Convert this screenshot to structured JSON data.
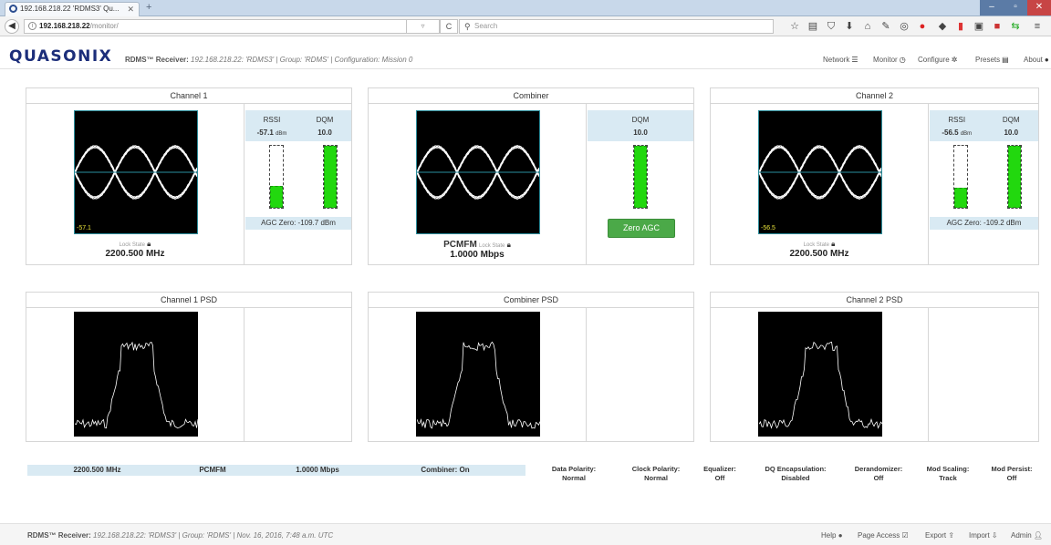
{
  "browser": {
    "tab_title": "192.168.218.22 'RDMS3' Qu...",
    "url_host": "192.168.218.22",
    "url_path": "/monitor/",
    "search_placeholder": "Search"
  },
  "header": {
    "brand": "QUASONIX",
    "info_bold": "RDMS™ Receiver:",
    "info_light": "192.168.218.22: 'RDMS3' | Group: 'RDMS' | Configuration: Mission 0",
    "nav": [
      {
        "label": "Network",
        "icon": "list-icon"
      },
      {
        "label": "Monitor",
        "icon": "clock-icon"
      },
      {
        "label": "Configure",
        "icon": "gear-icon"
      },
      {
        "label": "Presets",
        "icon": "preset-icon"
      },
      {
        "label": "About",
        "icon": "info-icon"
      }
    ]
  },
  "channel1": {
    "title": "Channel 1",
    "rssi_label": "RSSI",
    "dqm_label": "DQM",
    "rssi_value": "-57.1",
    "rssi_unit": "dBm",
    "dqm_value": "10.0",
    "rssi_level": 0.35,
    "dqm_level": 1.0,
    "agc": "AGC Zero: -109.7 dBm",
    "eye_label": "-57.1",
    "lock_state": "Lock State",
    "freq": "2200.500 MHz"
  },
  "combiner": {
    "title": "Combiner",
    "dqm_label": "DQM",
    "dqm_value": "10.0",
    "dqm_level": 1.0,
    "zero_btn": "Zero AGC",
    "mode": "PCMFM",
    "lock_state": "Lock State",
    "rate": "1.0000 Mbps"
  },
  "channel2": {
    "title": "Channel 2",
    "rssi_label": "RSSI",
    "dqm_label": "DQM",
    "rssi_value": "-56.5",
    "rssi_unit": "dBm",
    "dqm_value": "10.0",
    "rssi_level": 0.33,
    "dqm_level": 1.0,
    "agc": "AGC Zero: -109.2 dBm",
    "eye_label": "-56.5",
    "lock_state": "Lock State",
    "freq": "2200.500 MHz"
  },
  "psd": {
    "ch1_title": "Channel 1 PSD",
    "comb_title": "Combiner PSD",
    "ch2_title": "Channel 2 PSD"
  },
  "status_bar": {
    "freq": "2200.500 MHz",
    "mode": "PCMFM",
    "rate": "1.0000 Mbps",
    "combiner": "Combiner: On"
  },
  "config": [
    {
      "label": "Data Polarity:",
      "value": "Normal"
    },
    {
      "label": "Clock Polarity:",
      "value": "Normal"
    },
    {
      "label": "Equalizer:",
      "value": "Off"
    },
    {
      "label": "DQ Encapsulation:",
      "value": "Disabled"
    },
    {
      "label": "Derandomizer:",
      "value": "Off"
    },
    {
      "label": "Mod Scaling:",
      "value": "Track"
    },
    {
      "label": "Mod Persist:",
      "value": "Off"
    }
  ],
  "footer": {
    "info_bold": "RDMS™ Receiver:",
    "info_light": "192.168.218.22: 'RDMS3' | Group: 'RDMS' | Nov. 16, 2016, 7:48 a.m. UTC",
    "links": [
      "Help",
      "Page Access",
      "Export",
      "Import",
      "Admin"
    ]
  },
  "colors": {
    "meter_fill": "#22d80e",
    "header_band": "#d9eaf3",
    "zero_btn": "#4ba948",
    "brand": "#1c2e7a"
  }
}
